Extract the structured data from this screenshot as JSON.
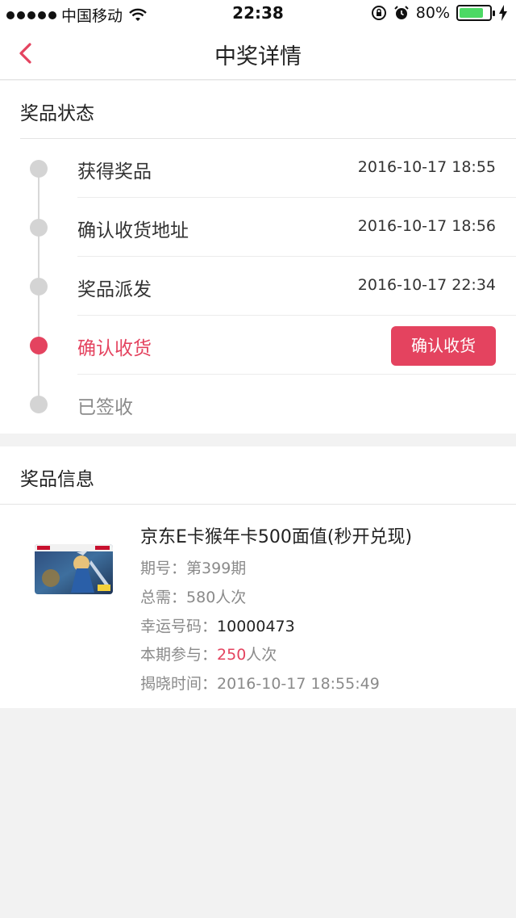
{
  "status_bar": {
    "carrier": "中国移动",
    "time": "22:38",
    "battery": "80%",
    "battery_level": 0.8
  },
  "nav": {
    "title": "中奖详情"
  },
  "status_section": {
    "title": "奖品状态",
    "steps": [
      {
        "label": "获得奖品",
        "time": "2016-10-17 18:55"
      },
      {
        "label": "确认收货地址",
        "time": "2016-10-17 18:56"
      },
      {
        "label": "奖品派发",
        "time": "2016-10-17 22:34"
      },
      {
        "label": "确认收货",
        "button": "确认收货"
      },
      {
        "label": "已签收"
      }
    ]
  },
  "info_section": {
    "title": "奖品信息",
    "prize_name": "京东E卡猴年卡500面值(秒开兑现)",
    "issue_label": "期号：",
    "issue_value": "第399期",
    "total_label": "总需：",
    "total_value": "580人次",
    "lucky_label": "幸运号码：",
    "lucky_value": "10000473",
    "joined_label": "本期参与：",
    "joined_count": "250",
    "joined_unit": "人次",
    "reveal_label": "揭晓时间：",
    "reveal_value": "2016-10-17 18:55:49"
  },
  "colors": {
    "accent": "#e4435f",
    "muted": "#8a8a8a",
    "background": "#f2f2f2"
  }
}
